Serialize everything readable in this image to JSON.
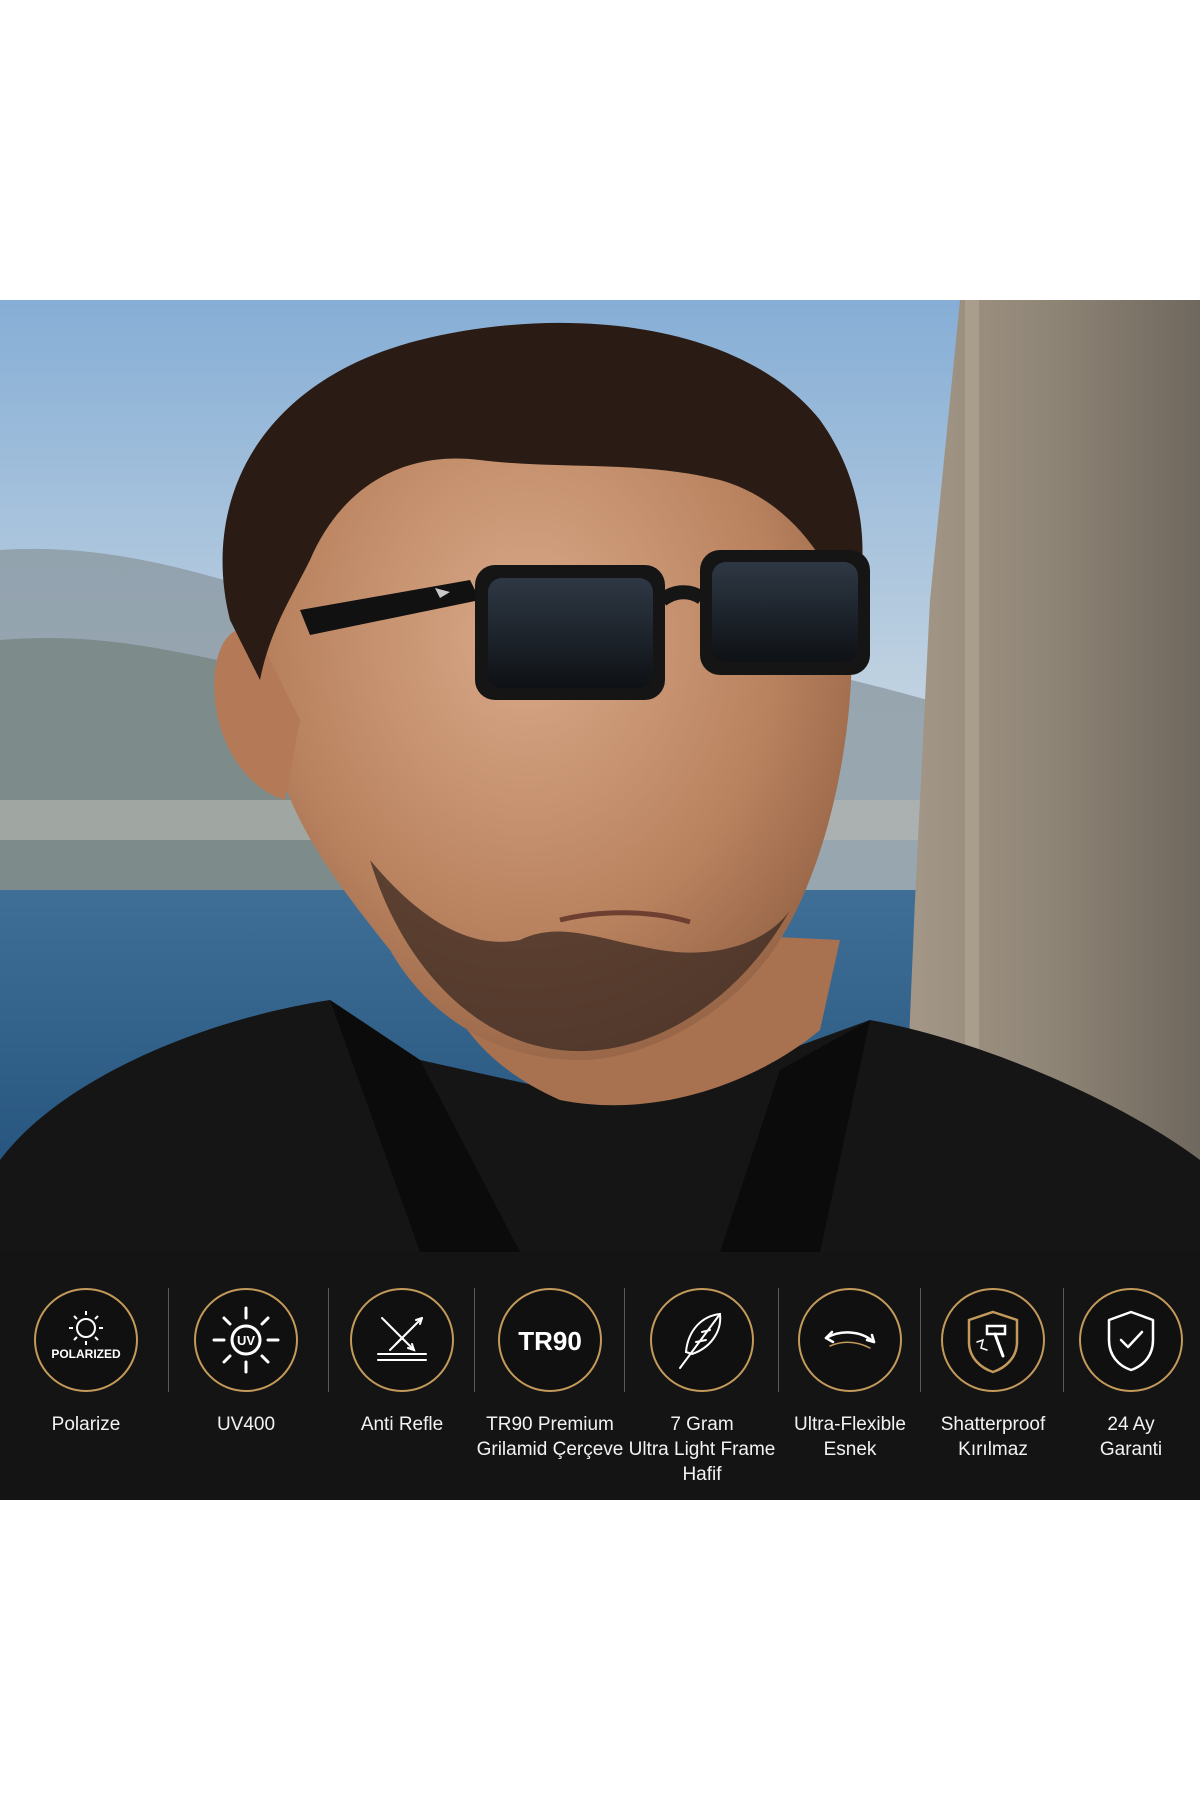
{
  "features": [
    {
      "icon": "polarized-sun-icon",
      "badge": "POLARIZED",
      "lines": [
        "Polarize"
      ]
    },
    {
      "icon": "uv-sun-icon",
      "badge": "UV",
      "lines": [
        "UV400"
      ]
    },
    {
      "icon": "anti-reflection-icon",
      "lines": [
        "Anti Refle"
      ]
    },
    {
      "icon": "tr90-icon",
      "badge": "TR90",
      "lines": [
        "TR90 Premium",
        "Grilamid Çerçeve"
      ]
    },
    {
      "icon": "feather-icon",
      "lines": [
        "7 Gram",
        "Ultra Light Frame",
        "Hafif"
      ]
    },
    {
      "icon": "flex-arrows-icon",
      "lines": [
        "Ultra-Flexible",
        "Esnek"
      ]
    },
    {
      "icon": "shatterproof-hammer-icon",
      "lines": [
        "Shatterproof",
        "Kırılmaz"
      ]
    },
    {
      "icon": "shield-check-icon",
      "lines": [
        "24 Ay",
        "Garanti"
      ]
    }
  ],
  "colors": {
    "accent_gold": "#c39a5a",
    "band_background": "#141414",
    "text": "#f2f2f2"
  }
}
